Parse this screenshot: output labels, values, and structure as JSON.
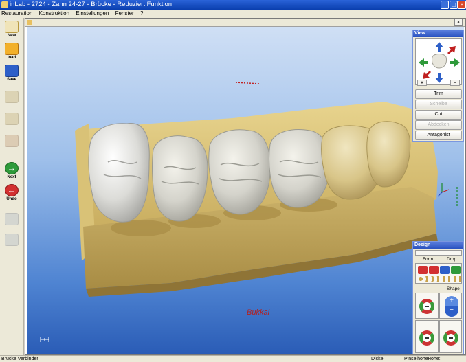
{
  "window": {
    "title": "inLab - 2724 - Zahn 24-27 - Brücke - Reduziert Funktion",
    "controls": [
      "minimize",
      "maximize",
      "close"
    ]
  },
  "menu": [
    "Restauration",
    "Konstruktion",
    "Einstellungen",
    "Fenster",
    "?"
  ],
  "toolbar": {
    "new": "New",
    "load": "load",
    "save": "Save",
    "next": "Next",
    "undo": "Undo"
  },
  "viewport": {
    "orientation_label": "Bukkal"
  },
  "view_panel": {
    "title": "View",
    "plus": "+",
    "minus": "−",
    "trim": "Trim",
    "disabled_1": "Scheibe",
    "cut": "Cut",
    "disabled_2": "Abdecken",
    "antagonist": "Antagonist"
  },
  "design_panel": {
    "title": "Design",
    "form": "Form",
    "drop": "Drop",
    "shape": "Shape"
  },
  "statusbar": {
    "left": "Brücke Verbinder",
    "dicke": "Dicke:",
    "pinsel": "Pinselhöhe:",
    "hoehe": "Höhe:"
  },
  "colors": {
    "title_bar": "#0a3fae",
    "model_gypsum": "#d8c27a",
    "tooth_white": "#eeeeea",
    "bukkal_label": "#b22020"
  }
}
